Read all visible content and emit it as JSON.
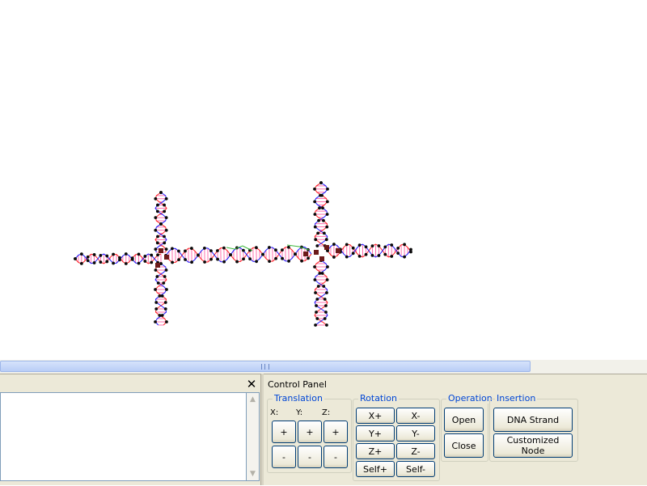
{
  "control_panel": {
    "title": "Control Panel",
    "close_symbol": "✕",
    "translation": {
      "legend": "Translation",
      "axes": [
        "X:",
        "Y:",
        "Z:"
      ],
      "plus": "+",
      "minus": "-"
    },
    "rotation": {
      "legend": "Rotation",
      "buttons": [
        "X+",
        "X-",
        "Y+",
        "Y-",
        "Z+",
        "Z-",
        "Self+",
        "Self-"
      ]
    },
    "operation": {
      "legend": "Operation",
      "open": "Open",
      "close": "Close"
    },
    "insertion": {
      "legend": "Insertion",
      "dna_strand": "DNA Strand",
      "customized_node": "Customized Node"
    }
  },
  "colors": {
    "backbone_a": "#ff2020",
    "backbone_b": "#1a1aff",
    "base_pairs": "#ff4f9a",
    "nucleotide": "#0a0a0a",
    "green_link": "#3cb83c",
    "junction": "#6b1a1a",
    "legend_text": "#0046d5",
    "panel_bg": "#ece9d8"
  }
}
